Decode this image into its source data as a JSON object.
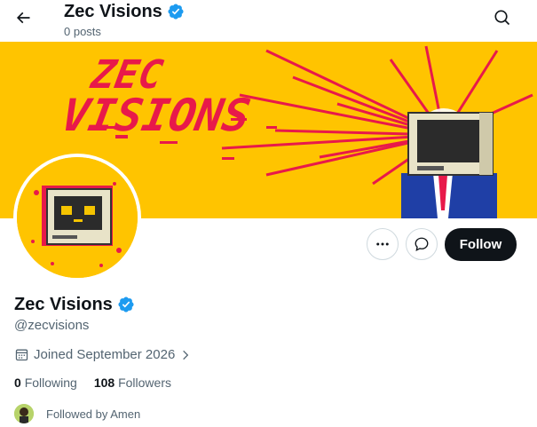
{
  "header": {
    "title": "Zec Visions",
    "posts_count": "0 posts"
  },
  "banner": {
    "text_line1": "ZEC",
    "text_line2": "VISIONS"
  },
  "actions": {
    "follow_label": "Follow"
  },
  "profile": {
    "name": "Zec Visions",
    "handle": "@zecvisions",
    "joined": "Joined September 2026",
    "following_count": "0",
    "following_label": "Following",
    "followers_count": "108",
    "followers_label": "Followers",
    "followed_by": "Followed by Amen"
  },
  "colors": {
    "banner_yellow": "#ffc400",
    "banner_red": "#e8194a",
    "verified_blue": "#1d9bf0",
    "follow_button": "#0f1419"
  }
}
